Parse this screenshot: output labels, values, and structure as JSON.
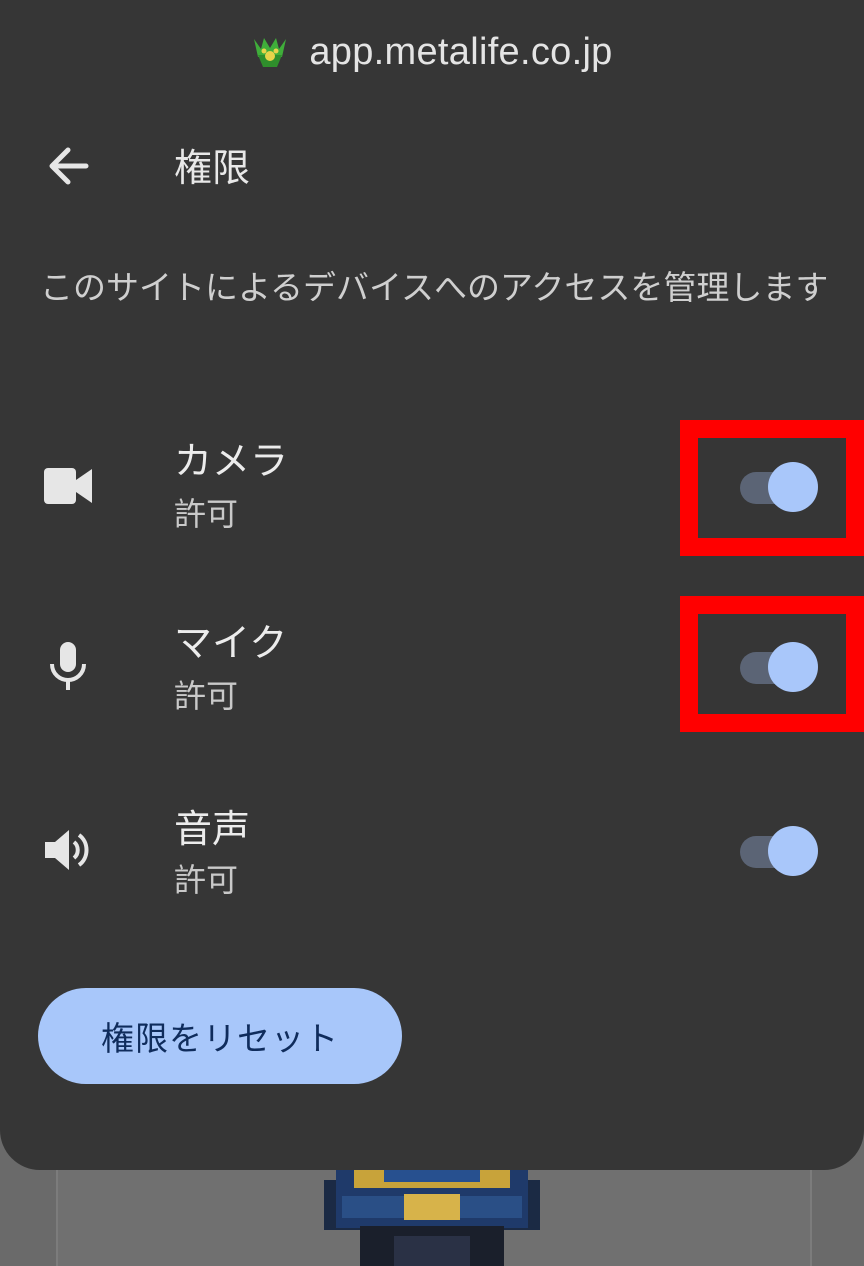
{
  "header": {
    "url": "app.metalife.co.jp",
    "logo_icon": "site-logo-icon"
  },
  "nav": {
    "back_icon": "arrow-back-icon",
    "title": "権限"
  },
  "description": "このサイトによるデバイスへのアクセスを管理します",
  "permissions": [
    {
      "name": "カメラ",
      "status": "許可",
      "icon": "camera-icon",
      "enabled": true,
      "highlighted": true
    },
    {
      "name": "マイク",
      "status": "許可",
      "icon": "microphone-icon",
      "enabled": true,
      "highlighted": true
    },
    {
      "name": "音声",
      "status": "許可",
      "icon": "speaker-icon",
      "enabled": true,
      "highlighted": false
    }
  ],
  "reset_button": {
    "label": "権限をリセット"
  },
  "colors": {
    "sheet_background": "#363636",
    "accent": "#a8c7fa",
    "toggle_track": "#5b6475",
    "highlight": "#ff0000",
    "button_text": "#0f2c5c"
  }
}
